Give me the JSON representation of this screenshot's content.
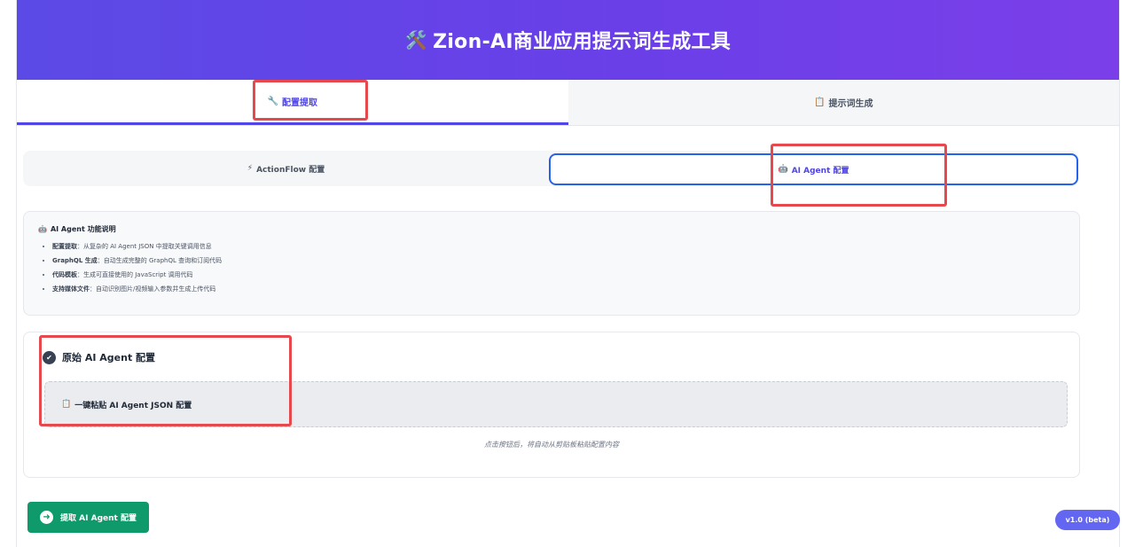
{
  "header": {
    "icon": "🛠️",
    "title": "Zion-AI商业应用提示词生成工具"
  },
  "main_tabs": [
    {
      "icon": "🔧",
      "label": "配置提取",
      "active": true
    },
    {
      "icon": "📋",
      "label": "提示词生成",
      "active": false
    }
  ],
  "sub_tabs": [
    {
      "icon": "⚡",
      "label": "ActionFlow 配置",
      "active": false
    },
    {
      "icon": "🤖",
      "label": "AI Agent 配置",
      "active": true
    }
  ],
  "info": {
    "icon": "🤖",
    "title": "AI Agent 功能说明",
    "items": [
      {
        "term": "配置提取",
        "desc": "：从复杂的 AI Agent JSON 中提取关键调用信息"
      },
      {
        "term": "GraphQL 生成",
        "desc": "：自动生成完整的 GraphQL 查询和订阅代码"
      },
      {
        "term": "代码模板",
        "desc": "：生成可直接使用的 JavaScript 调用代码"
      },
      {
        "term": "支持媒体文件",
        "desc": "：自动识别图片/视频输入参数并生成上传代码"
      }
    ]
  },
  "config": {
    "check_icon": "✔",
    "heading": "原始 AI Agent 配置",
    "paste_icon": "📋",
    "paste_label": "一键粘贴 AI Agent JSON 配置",
    "hint": "点击按钮后，将自动从剪贴板粘贴配置内容"
  },
  "extract_button": {
    "icon": "➜",
    "label": "提取 AI Agent 配置"
  },
  "version": "v1.0 (beta)",
  "colors": {
    "accent": "#4f46e5",
    "header_start": "#5b4ae6",
    "header_end": "#7b3fe9",
    "extract_button": "#0f9a6b",
    "version_badge": "#6366f1",
    "annotation": "#e5484d"
  }
}
